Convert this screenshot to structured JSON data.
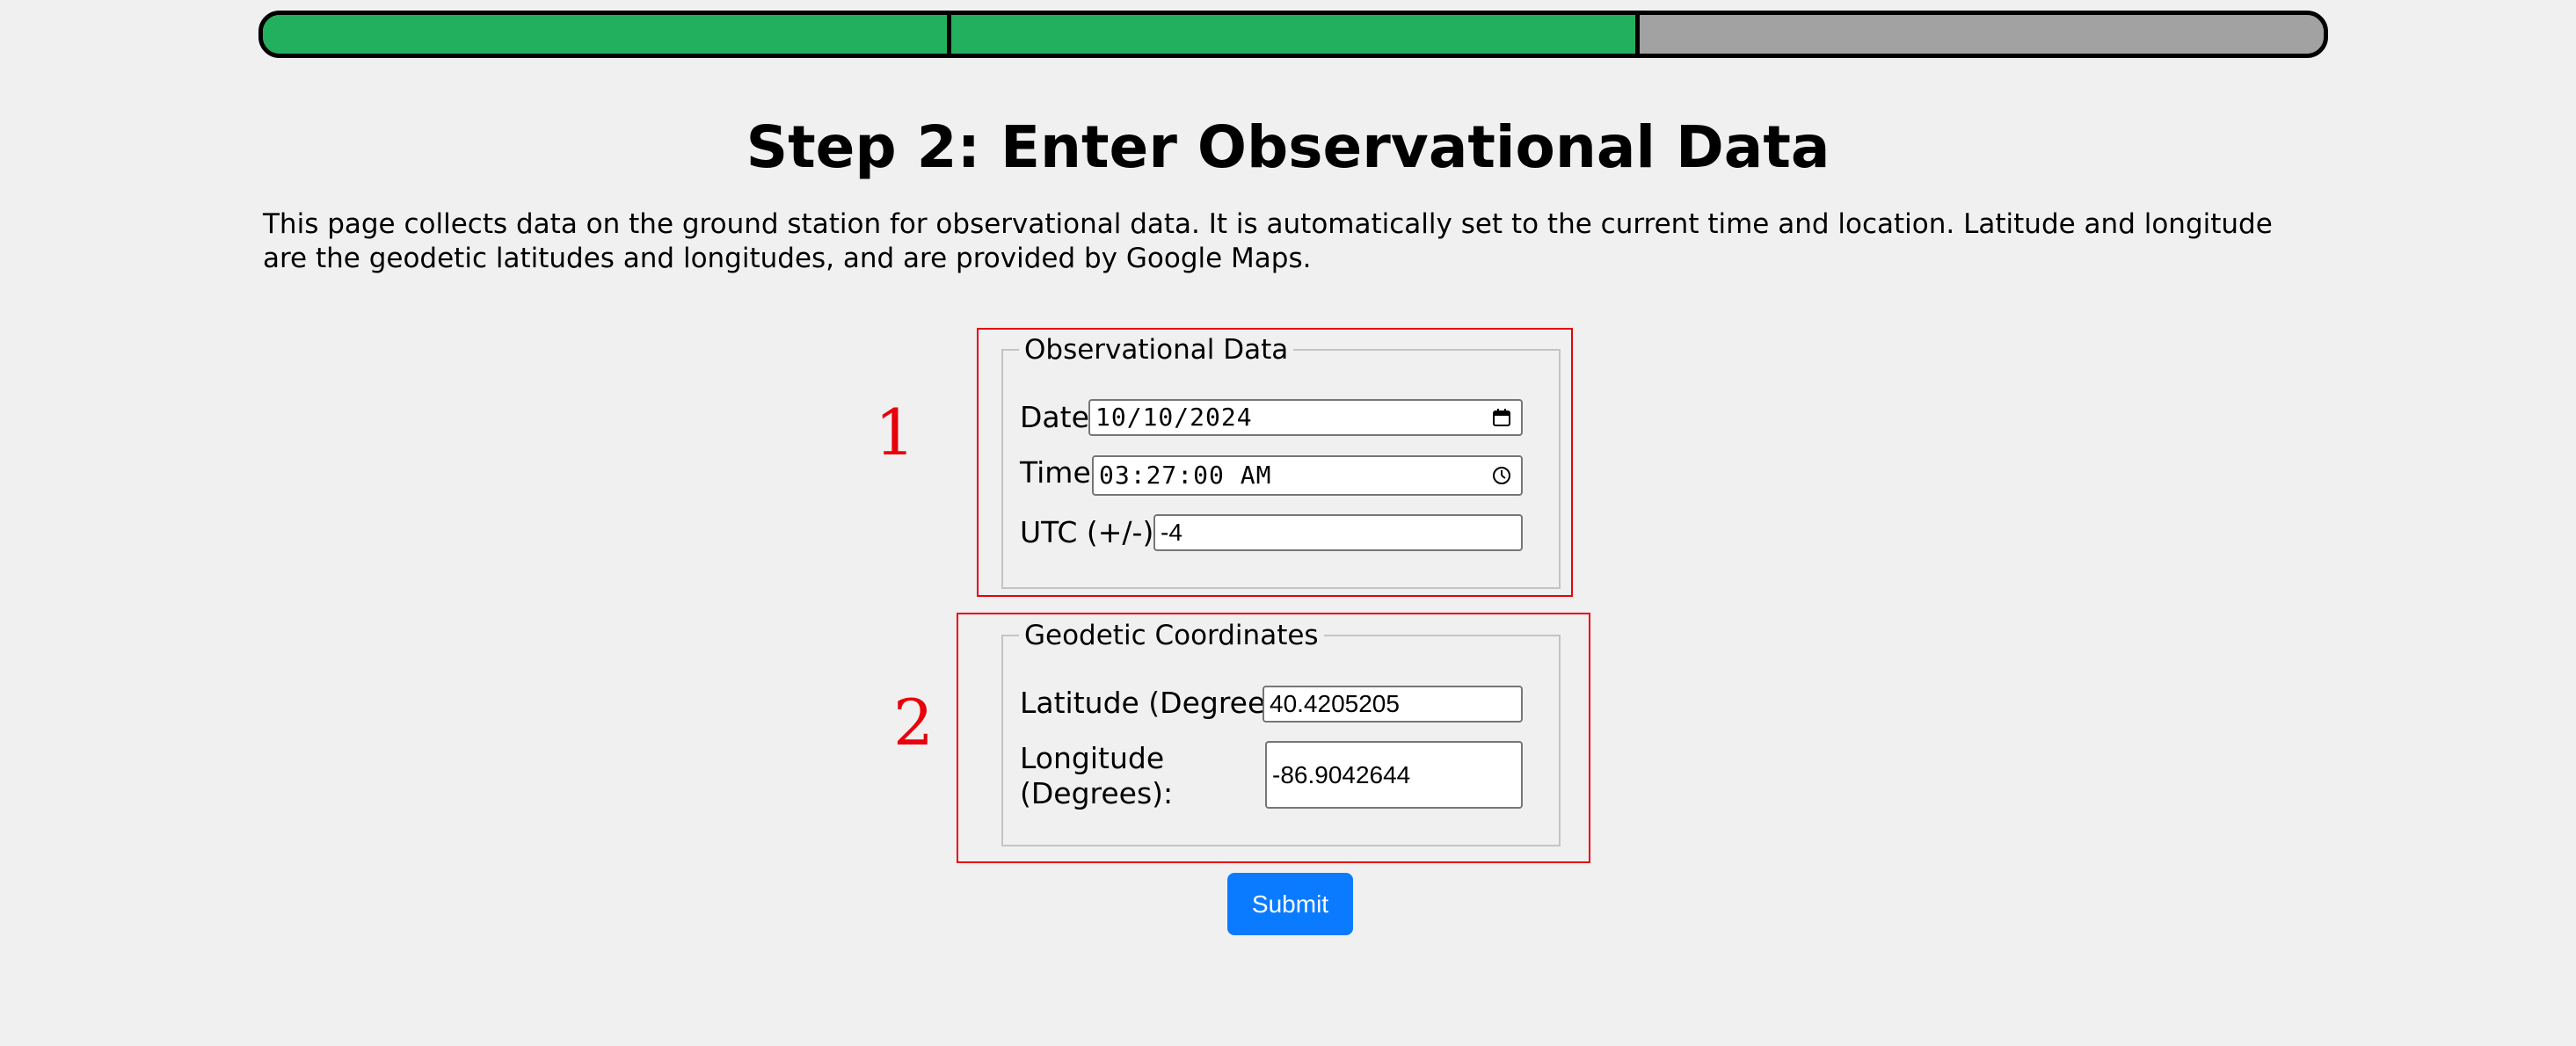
{
  "progress": {
    "steps_total": 3,
    "steps_completed": 2,
    "complete_color": "#23b05e",
    "incomplete_color": "#a2a2a2"
  },
  "header": {
    "title": "Step 2: Enter Observational Data"
  },
  "intro": {
    "text": "This page collects data on the ground station for observational data. It is automatically set to the current time and location. Latitude and longitude are the geodetic latitudes and longitudes, and are provided by Google Maps."
  },
  "annotations": {
    "box1_number": "1",
    "box2_number": "2",
    "color": "#e8000b"
  },
  "observational": {
    "legend": "Observational Data",
    "date_label": "Date:",
    "date_value": "10/10/2024",
    "date_icon": "calendar-icon",
    "time_label": "Time:",
    "time_value": "03:27:00 AM",
    "time_icon": "clock-icon",
    "utc_label": "UTC (+/-):",
    "utc_value": "-4"
  },
  "geodetic": {
    "legend": "Geodetic Coordinates",
    "lat_label": "Latitude (Degrees):",
    "lat_value": "40.4205205",
    "lon_label_line1": "Longitude",
    "lon_label_line2": "(Degrees):",
    "lon_value": "-86.9042644"
  },
  "submit": {
    "label": "Submit",
    "color": "#0a7bff"
  }
}
